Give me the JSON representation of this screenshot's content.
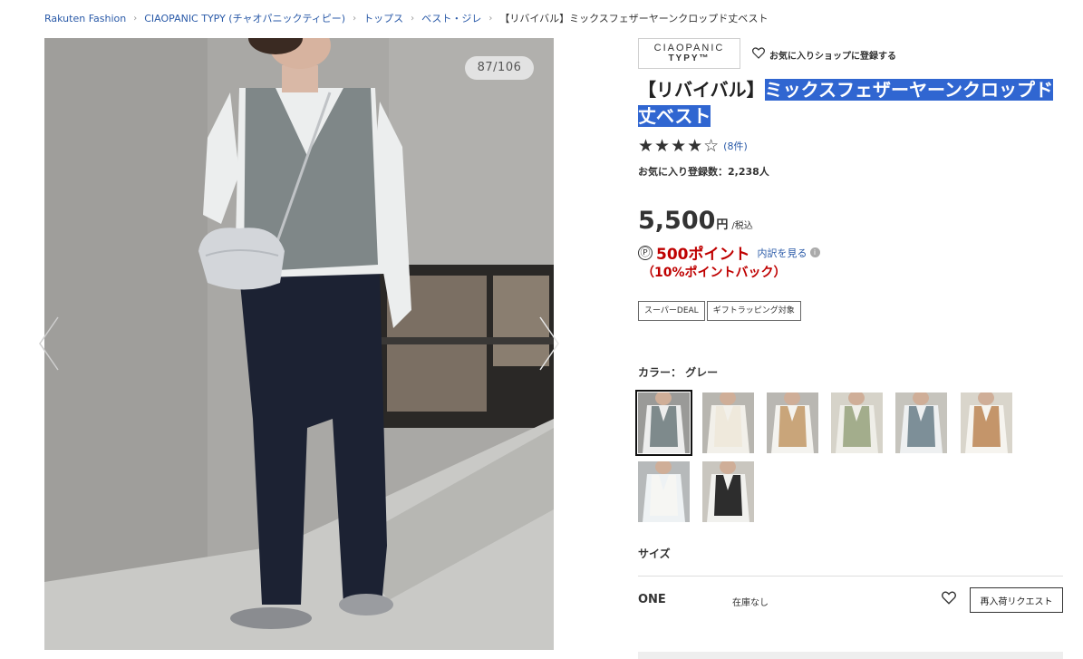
{
  "breadcrumb": [
    {
      "label": "Rakuten Fashion"
    },
    {
      "label": "CIAOPANIC TYPY (チャオパニックティピー)"
    },
    {
      "label": "トップス"
    },
    {
      "label": "ベスト・ジレ"
    },
    {
      "label": "【リバイバル】ミックスフェザーヤーンクロップド丈ベスト"
    }
  ],
  "gallery": {
    "counter": "87/106"
  },
  "brand": {
    "logo_line1": "CIAOPANIC",
    "logo_line2": "TYPY™",
    "favorite_shop_label": "お気に入りショップに登録する"
  },
  "product": {
    "title_prefix": "【リバイバル】",
    "title_highlighted": "ミックスフェザーヤーンクロップド丈ベスト",
    "rating": {
      "stars": "★★★★☆",
      "value": 4,
      "count_label": "(8件)"
    },
    "favorite_count": "お気に入り登録数：2,238人",
    "price": {
      "amount": "5,500",
      "unit": "円",
      "tax_label": "/税込"
    },
    "points": {
      "icon": "Ⓟ",
      "label": "500ポイント",
      "detail_link": "内訳を見る",
      "pointback": "（10%ポイントバック）"
    },
    "tags": [
      "スーパーDEAL",
      "ギフトラッピング対象"
    ],
    "color_label": "カラー： グレー",
    "swatches": [
      {
        "name": "グレー",
        "top": "#ededed",
        "vest": "#7e8a8c",
        "bg": "#9a9a98",
        "selected": true
      },
      {
        "name": "アイボリー",
        "top": "#f2f0ea",
        "vest": "#efe9dc",
        "bg": "#b8b6b0",
        "selected": false
      },
      {
        "name": "ベージュ",
        "top": "#f4f3ef",
        "vest": "#c9a57a",
        "bg": "#b9b7b2",
        "selected": false
      },
      {
        "name": "カーキ",
        "top": "#efeee8",
        "vest": "#a3ad8c",
        "bg": "#d6d3c9",
        "selected": false
      },
      {
        "name": "ブルーグレー",
        "top": "#eef0f1",
        "vest": "#7d8f98",
        "bg": "#c6c4bd",
        "selected": false
      },
      {
        "name": "キャメル",
        "top": "#f6f4ef",
        "vest": "#c4956a",
        "bg": "#d9d5cb",
        "selected": false
      },
      {
        "name": "ホワイト",
        "top": "#eef2f4",
        "vest": "#f6f6f3",
        "bg": "#b6b9ba",
        "selected": false
      },
      {
        "name": "ブラック",
        "top": "#f1f1ee",
        "vest": "#2d2d2d",
        "bg": "#c9c6bf",
        "selected": false
      }
    ],
    "size_label": "サイズ",
    "sizes": [
      {
        "name": "ONE",
        "stock": "在庫なし",
        "restock_label": "再入荷リクエスト"
      }
    ]
  },
  "colors": {
    "link": "#2a5aa8",
    "point_red": "#bf0000",
    "title_highlight": "#3066d1"
  },
  "icons": {
    "breadcrumb_separator": "chevron-right-icon",
    "favorite": "heart-icon",
    "prev": "chevron-left-icon",
    "next": "chevron-right-icon",
    "info": "info-icon"
  }
}
